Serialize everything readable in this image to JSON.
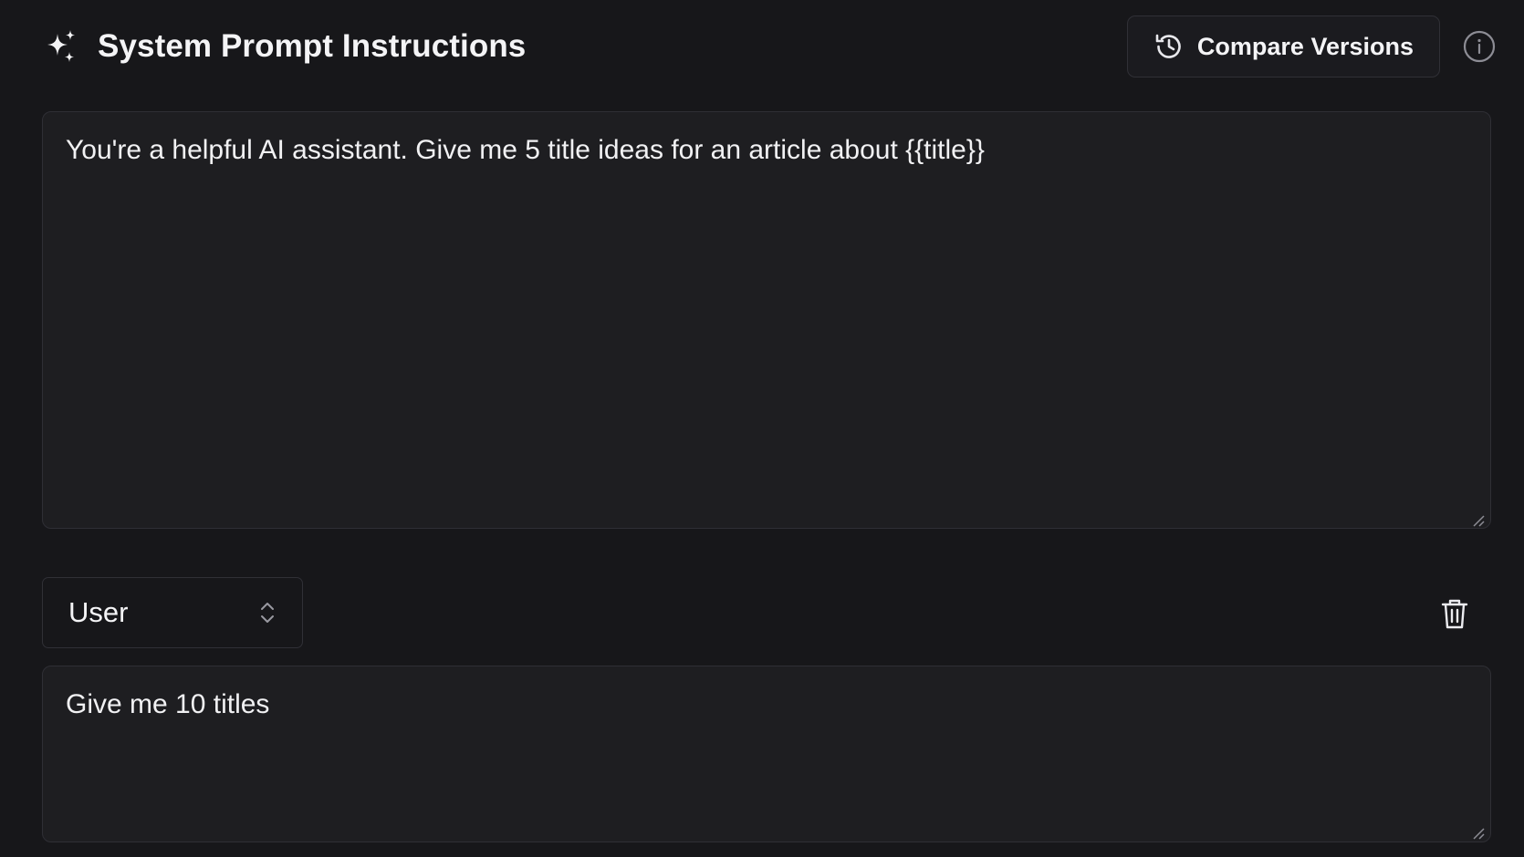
{
  "header": {
    "title": "System Prompt Instructions",
    "title_icon": "sparkles-icon",
    "compare_button": {
      "label": "Compare Versions",
      "icon": "history-icon"
    },
    "info_icon": "info-icon"
  },
  "system_prompt": {
    "value": "You're a helpful AI assistant. Give me 5 title ideas for an article about {{title}}"
  },
  "message": {
    "role": {
      "selected": "User",
      "icon": "chevrons-up-down-icon"
    },
    "delete_icon": "trash-icon",
    "value": "Give me 10 titles"
  },
  "colors": {
    "background": "#17171a",
    "surface": "#1e1e21",
    "border": "#2f2f35",
    "text": "#f1f1f3",
    "muted": "#9a9aa2"
  }
}
